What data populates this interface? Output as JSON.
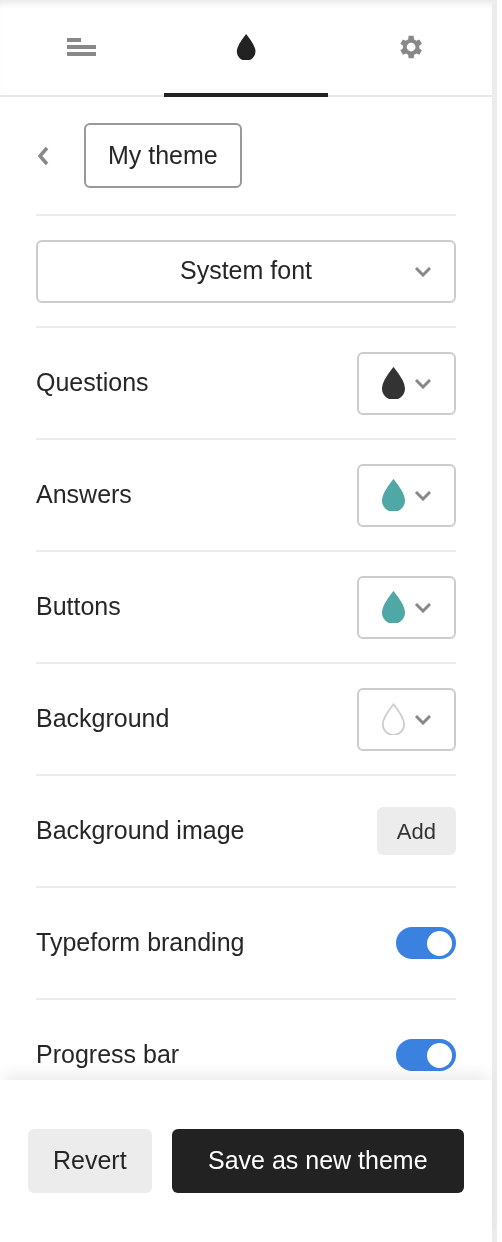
{
  "tabs": [
    {
      "kind": "outline",
      "selected": false
    },
    {
      "kind": "design",
      "selected": true
    },
    {
      "kind": "settings",
      "selected": false
    }
  ],
  "theme_name": "My theme",
  "font_select": {
    "value": "System font"
  },
  "rows": [
    {
      "kind": "color",
      "label": "Questions",
      "color": "#333333",
      "filled": true
    },
    {
      "kind": "color",
      "label": "Answers",
      "color": "#4fa8a5",
      "filled": true
    },
    {
      "kind": "color",
      "label": "Buttons",
      "color": "#4fa8a5",
      "filled": true
    },
    {
      "kind": "color",
      "label": "Background",
      "color": "#cccccc",
      "filled": false
    },
    {
      "kind": "button",
      "label": "Background image",
      "button": "Add"
    },
    {
      "kind": "toggle",
      "label": "Typeform branding",
      "on": true
    },
    {
      "kind": "toggle",
      "label": "Progress bar",
      "on": true
    }
  ],
  "footer": {
    "secondary": "Revert",
    "primary": "Save as new theme"
  }
}
